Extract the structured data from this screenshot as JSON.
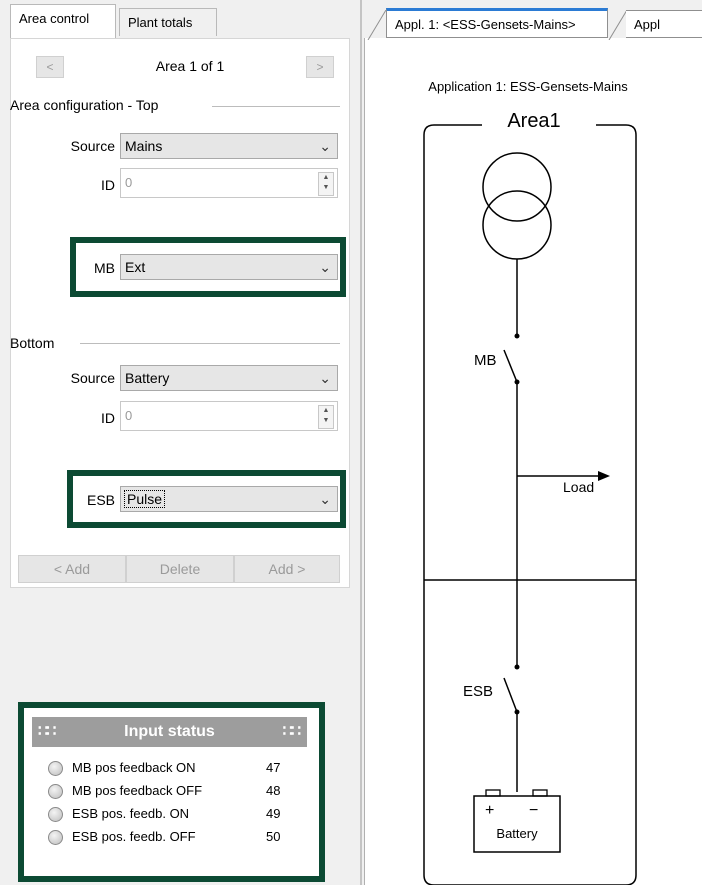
{
  "left_tabs": [
    "Area control",
    "Plant totals"
  ],
  "area_nav": {
    "prev": "<",
    "label": "Area 1 of 1",
    "next": ">"
  },
  "top_group": {
    "title": "Area configuration - Top",
    "source_label": "Source",
    "source_value": "Mains",
    "id_label": "ID",
    "id_value": "0",
    "breaker_label": "MB",
    "breaker_value": "Ext"
  },
  "bottom_group": {
    "title": "Bottom",
    "source_label": "Source",
    "source_value": "Battery",
    "id_label": "ID",
    "id_value": "0",
    "breaker_label": "ESB",
    "breaker_value": "Pulse"
  },
  "area_buttons": {
    "add_left": "< Add",
    "delete": "Delete",
    "add_right": "Add >"
  },
  "input_status": {
    "title": "Input status",
    "rows": [
      {
        "label": "MB pos feedback ON",
        "num": "47"
      },
      {
        "label": "MB pos feedback OFF",
        "num": "48"
      },
      {
        "label": "ESB pos. feedb. ON",
        "num": "49"
      },
      {
        "label": "ESB pos. feedb. OFF",
        "num": "50"
      }
    ]
  },
  "right_tabs": [
    "Appl. 1: <ESS-Gensets-Mains>",
    "Appl"
  ],
  "diagram": {
    "app_title": "Application 1: ESS-Gensets-Mains",
    "area_label": "Area1",
    "mb_label": "MB",
    "load_label": "Load",
    "esb_label": "ESB",
    "battery_plus": "+",
    "battery_minus": "−",
    "battery_label": "Battery"
  },
  "colors": {
    "highlight_box": "#0c4a33",
    "status_header": "#9d9d9d",
    "active_tab_accent": "#2b7bd4"
  }
}
